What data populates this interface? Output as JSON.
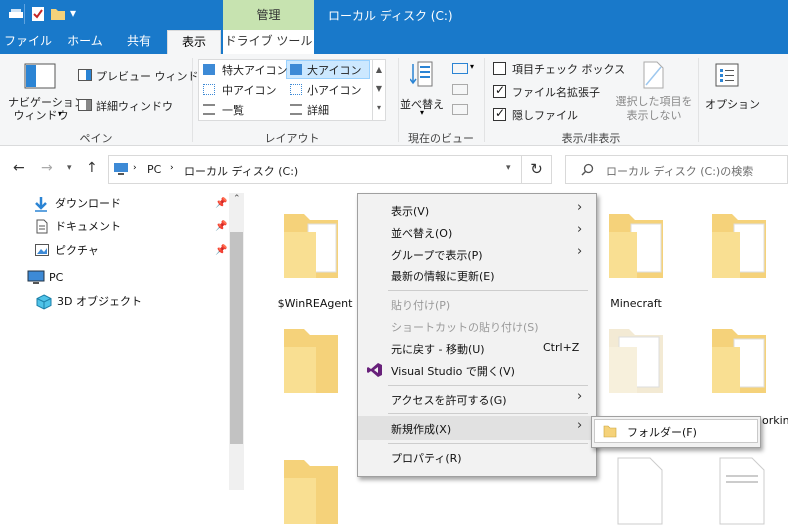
{
  "window": {
    "title": "ローカル ディスク (C:)",
    "manage_tab": "管理"
  },
  "tabs": [
    "ファイル",
    "ホーム",
    "共有",
    "表示",
    "ドライブ ツール"
  ],
  "ribbon": {
    "pane_group": {
      "nav_pane": "ナビゲーション\nウィンドウ",
      "preview": "プレビュー ウィンドウ",
      "details": "詳細ウィンドウ",
      "label": "ペイン"
    },
    "layout_group": {
      "items": [
        "特大アイコン",
        "大アイコン",
        "中アイコン",
        "小アイコン",
        "一覧",
        "詳細"
      ],
      "label": "レイアウト"
    },
    "current_view_group": {
      "sort": "並べ替え",
      "label": "現在のビュー"
    },
    "showhide_group": {
      "item_checkboxes": "項目チェック ボックス",
      "file_ext": "ファイル名拡張子",
      "hidden_items": "隠しファイル",
      "hide_selected": "選択した項目を\n表示しない",
      "label": "表示/非表示"
    },
    "options": "オプション"
  },
  "address": {
    "pc": "PC",
    "drive": "ローカル ディスク (C:)",
    "search_placeholder": "ローカル ディスク (C:)の検索"
  },
  "nav": {
    "downloads": "ダウンロード",
    "documents": "ドキュメント",
    "pictures": "ピクチャ",
    "pc": "PC",
    "objects3d": "3D オブジェクト"
  },
  "folders": {
    "winre": "$WinREAgent",
    "minecraft": "Minecraft",
    "working": "orkin"
  },
  "context_menu": {
    "view": "表示(V)",
    "sort": "並べ替え(O)",
    "group": "グループで表示(P)",
    "refresh": "最新の情報に更新(E)",
    "paste": "貼り付け(P)",
    "paste_shortcut": "ショートカットの貼り付け(S)",
    "undo": "元に戻す - 移動(U)",
    "undo_shortcut": "Ctrl+Z",
    "vs_open": "Visual Studio で開く(V)",
    "access": "アクセスを許可する(G)",
    "new": "新規作成(X)",
    "properties": "プロパティ(R)"
  },
  "submenu": {
    "folder": "フォルダー(F)"
  },
  "colors": {
    "titlebar": "#1979ca",
    "manage": "#c7e3b0",
    "folder": "#f5d27a",
    "menu_bg": "#f2f2f2",
    "vs_purple": "#68217a"
  }
}
